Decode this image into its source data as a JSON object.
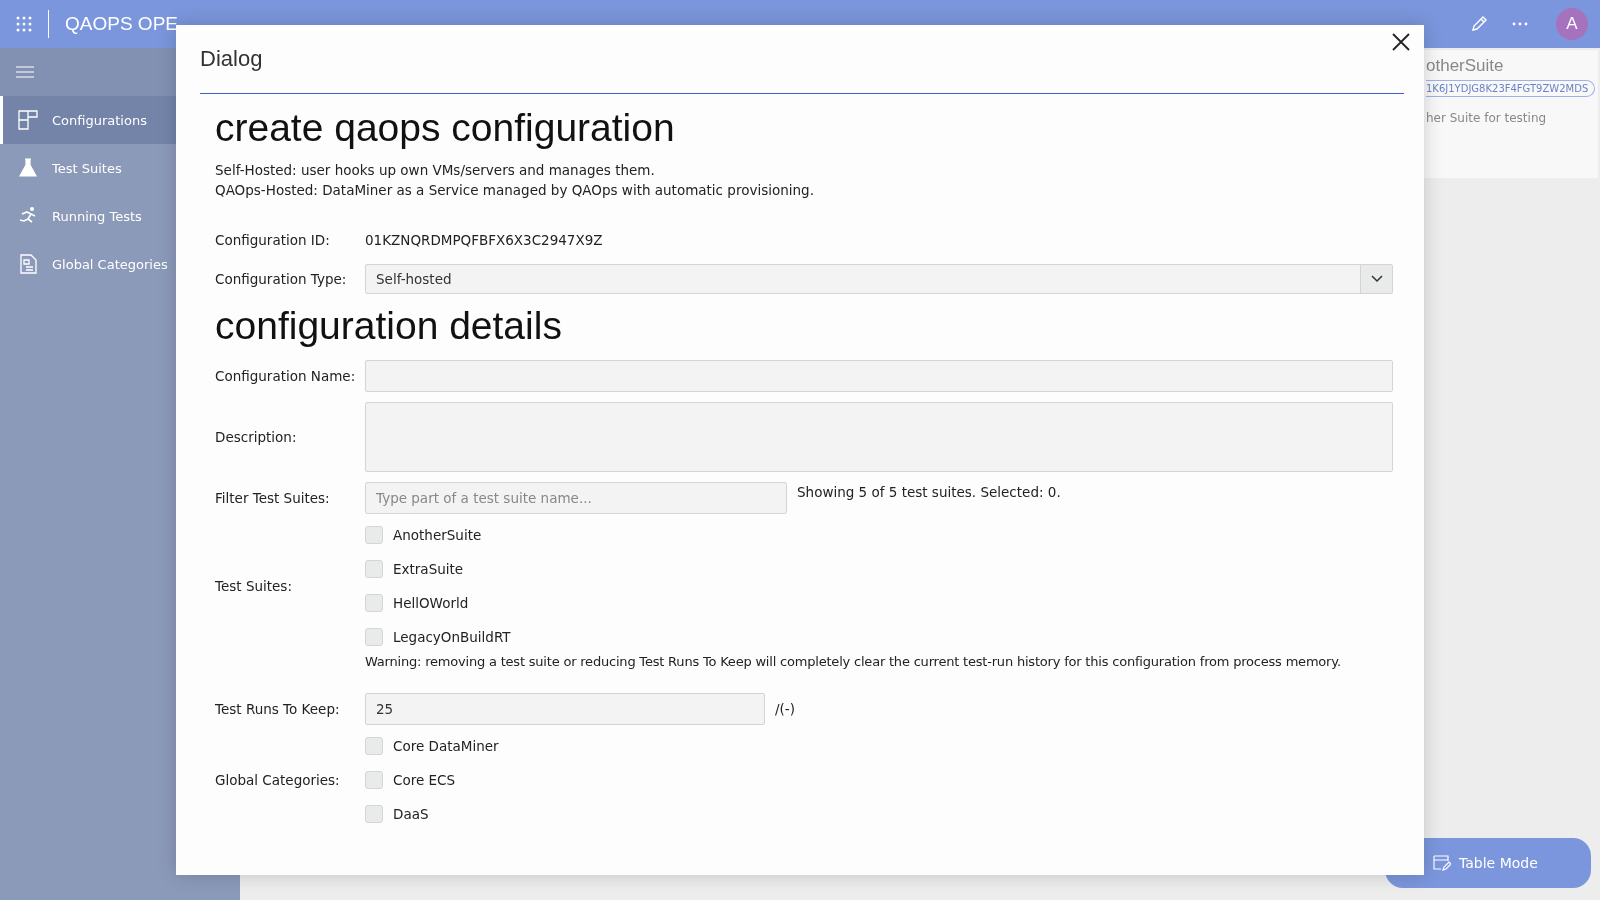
{
  "app_bar": {
    "title": "QAOPS OPE",
    "avatar": "A"
  },
  "sidebar": {
    "items": [
      {
        "label": "Configurations",
        "selected": true
      },
      {
        "label": "Test Suites",
        "selected": false
      },
      {
        "label": "Running Tests",
        "selected": false
      },
      {
        "label": "Global Categories",
        "selected": false
      }
    ]
  },
  "background_card": {
    "title": "otherSuite",
    "id": "1K6J1YDJG8K23F4FGT9ZW2MDS",
    "description": "her Suite for testing"
  },
  "table_mode_button": "Table Mode",
  "dialog": {
    "title": "Dialog",
    "heading": "create qaops configuration",
    "notes": [
      "Self-Hosted: user hooks up own VMs/servers and manages them.",
      "QAOps-Hosted: DataMiner as a Service managed by QAOps with automatic provisioning."
    ],
    "configuration_id": {
      "label": "Configuration ID:",
      "value": "01KZNQRDMPQFBFX6X3C2947X9Z"
    },
    "configuration_type": {
      "label": "Configuration Type:",
      "value": "Self-hosted"
    },
    "details_heading": "configuration details",
    "configuration_name": {
      "label": "Configuration Name:"
    },
    "description": {
      "label": "Description:"
    },
    "filter": {
      "label": "Filter Test Suites:",
      "placeholder": "Type part of a test suite name...",
      "status": "Showing 5 of 5 test suites. Selected: 0."
    },
    "test_suites": {
      "label": "Test Suites:",
      "items": [
        {
          "label": "AnotherSuite",
          "checked": false
        },
        {
          "label": "ExtraSuite",
          "checked": false
        },
        {
          "label": "HellOWorld",
          "checked": false
        },
        {
          "label": "LegacyOnBuildRT",
          "checked": false
        }
      ]
    },
    "warning": "Warning: removing a test suite or reducing Test Runs To Keep will completely clear the current test-run history for this configuration from process memory.",
    "test_runs_to_keep": {
      "label": "Test Runs To Keep:",
      "value": "25",
      "suffix": "/(-)"
    },
    "global_categories": {
      "label": "Global Categories:",
      "items": [
        {
          "label": "Core DataMiner",
          "checked": false
        },
        {
          "label": "Core ECS",
          "checked": false
        },
        {
          "label": "DaaS",
          "checked": false
        }
      ]
    }
  }
}
